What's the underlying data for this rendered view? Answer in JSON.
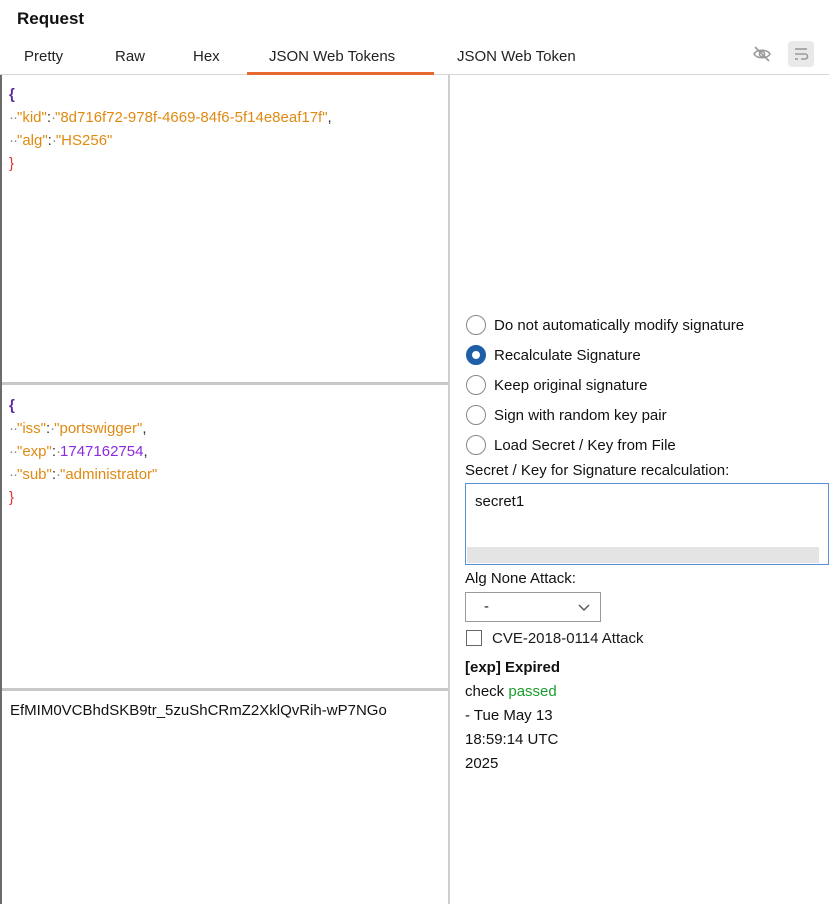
{
  "header": {
    "title": "Request"
  },
  "tabs": [
    {
      "label": "Pretty"
    },
    {
      "label": "Raw"
    },
    {
      "label": "Hex"
    },
    {
      "label": "JSON Web Tokens",
      "active": true
    },
    {
      "label": "JSON Web Token"
    }
  ],
  "toolbar": {
    "icons": [
      "eye-slash-icon",
      "wrap-lines-icon"
    ]
  },
  "jwt_header": {
    "kid_key": "\"kid\"",
    "kid_value": "\"8d716f72-978f-4669-84f6-5f14e8eaf17f\"",
    "alg_key": "\"alg\"",
    "alg_value": "\"HS256\""
  },
  "jwt_payload": {
    "iss_key": "\"iss\"",
    "iss_value": "\"portswigger\"",
    "exp_key": "\"exp\"",
    "exp_value": "1747162754",
    "sub_key": "\"sub\"",
    "sub_value": "\"administrator\""
  },
  "jwt_signature": {
    "value": "EfMIM0VCBhdSKB9tr_5zuShCRmZ2XklQvRih-wP7NGo"
  },
  "signature_options": [
    {
      "label": "Do not automatically modify signature",
      "checked": false
    },
    {
      "label": "Recalculate Signature",
      "checked": true
    },
    {
      "label": "Keep original signature",
      "checked": false
    },
    {
      "label": "Sign with random key pair",
      "checked": false
    },
    {
      "label": "Load Secret / Key from File",
      "checked": false
    }
  ],
  "secret": {
    "label": "Secret / Key for Signature recalculation:",
    "value": "secret1"
  },
  "alg_none": {
    "label": "Alg None Attack:",
    "selected": "-"
  },
  "cve": {
    "label": "CVE-2018-0114 Attack",
    "checked": false
  },
  "exp_check": {
    "title": "[exp] Expired",
    "check_word": "check",
    "status": "passed",
    "line1": "- Tue May 13",
    "line2": "18:59:14 UTC",
    "line3": "2025"
  },
  "colors": {
    "accent": "#e8692f",
    "radio_selected": "#1f5fa8",
    "json_string": "#e08a12",
    "json_number": "#8a2be2",
    "passed": "#1a9e2e"
  }
}
